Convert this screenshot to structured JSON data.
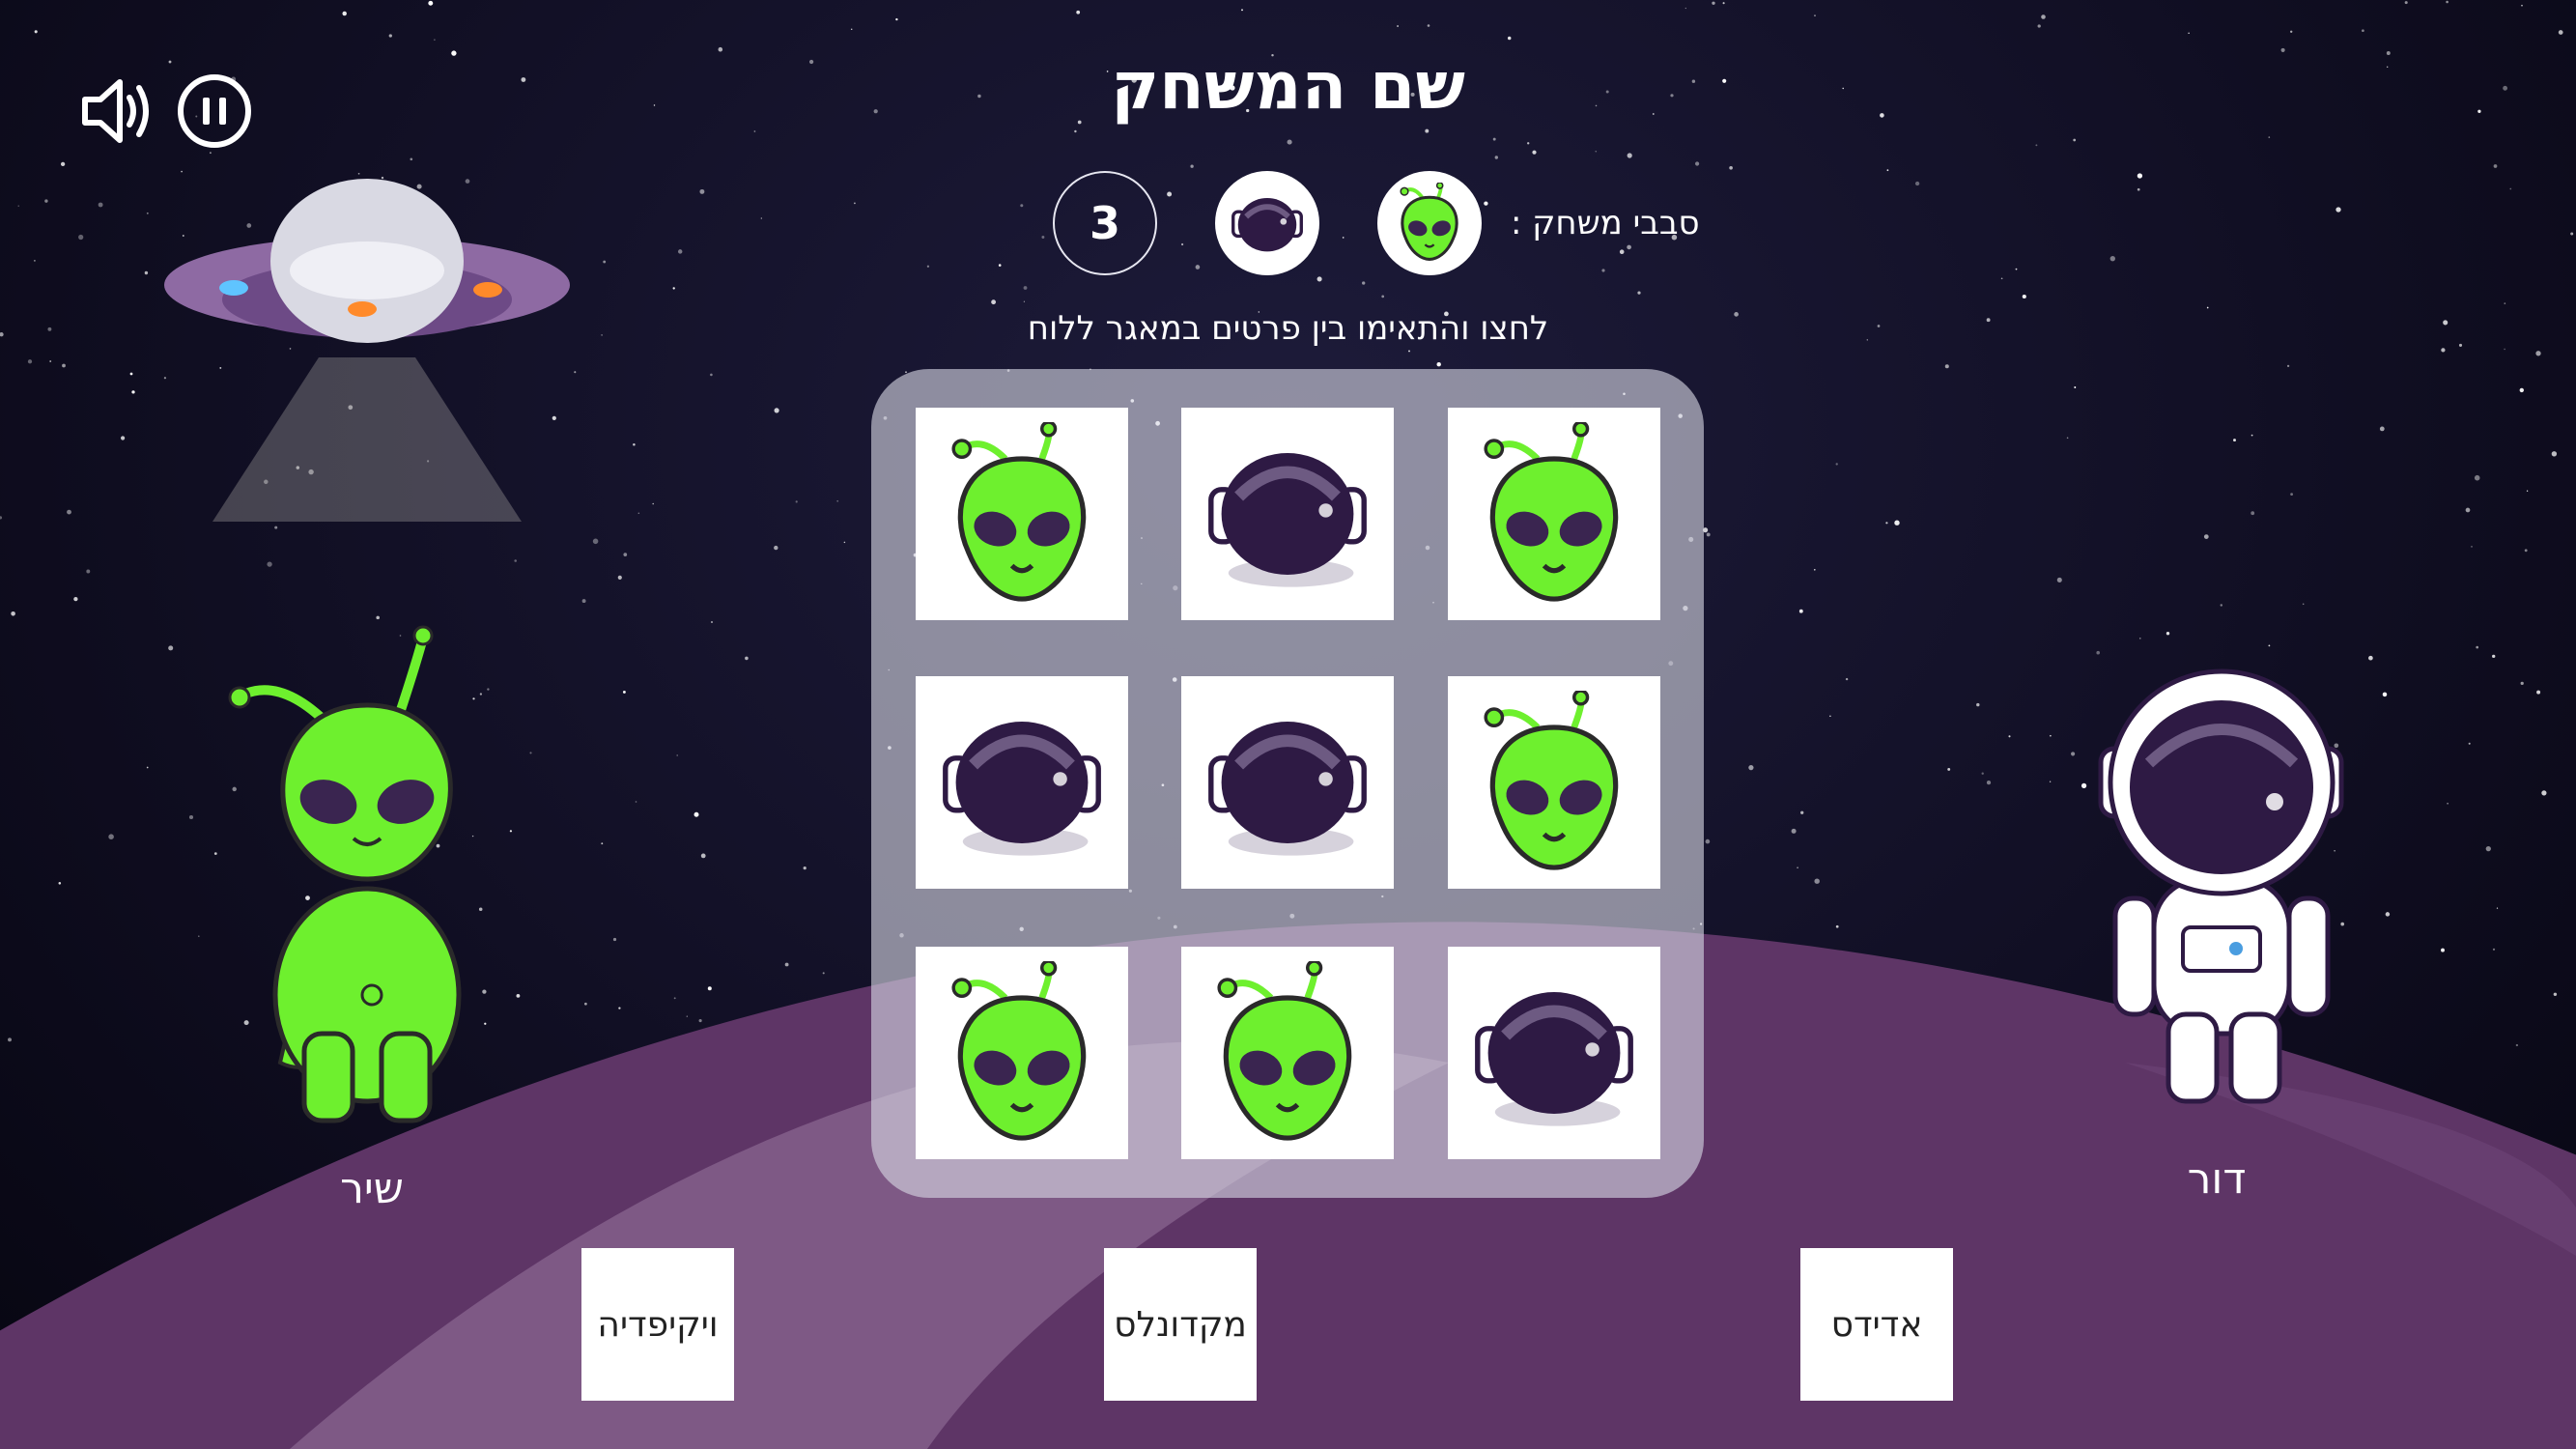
{
  "game": {
    "title": "שם המשחק",
    "rounds_label": "סבבי משחק :",
    "rounds_remaining": "3",
    "instruction": "לחצו והתאימו בין פרטים במאגר ללוח"
  },
  "rounds_icons": [
    "astronaut-helmet-icon",
    "alien-head-icon"
  ],
  "board": {
    "tiles": [
      "alien",
      "helmet",
      "alien",
      "helmet",
      "helmet",
      "alien",
      "alien",
      "alien",
      "helmet"
    ]
  },
  "characters": {
    "left_name": "שיר",
    "right_name": "דור"
  },
  "answers": {
    "left": "ויקיפדיה",
    "middle": "מקדונלס",
    "right": "אדידס"
  },
  "colors": {
    "alien_green": "#6ef02e",
    "helmet_purple": "#2e1a44",
    "planet_purple": "#5e3566"
  }
}
